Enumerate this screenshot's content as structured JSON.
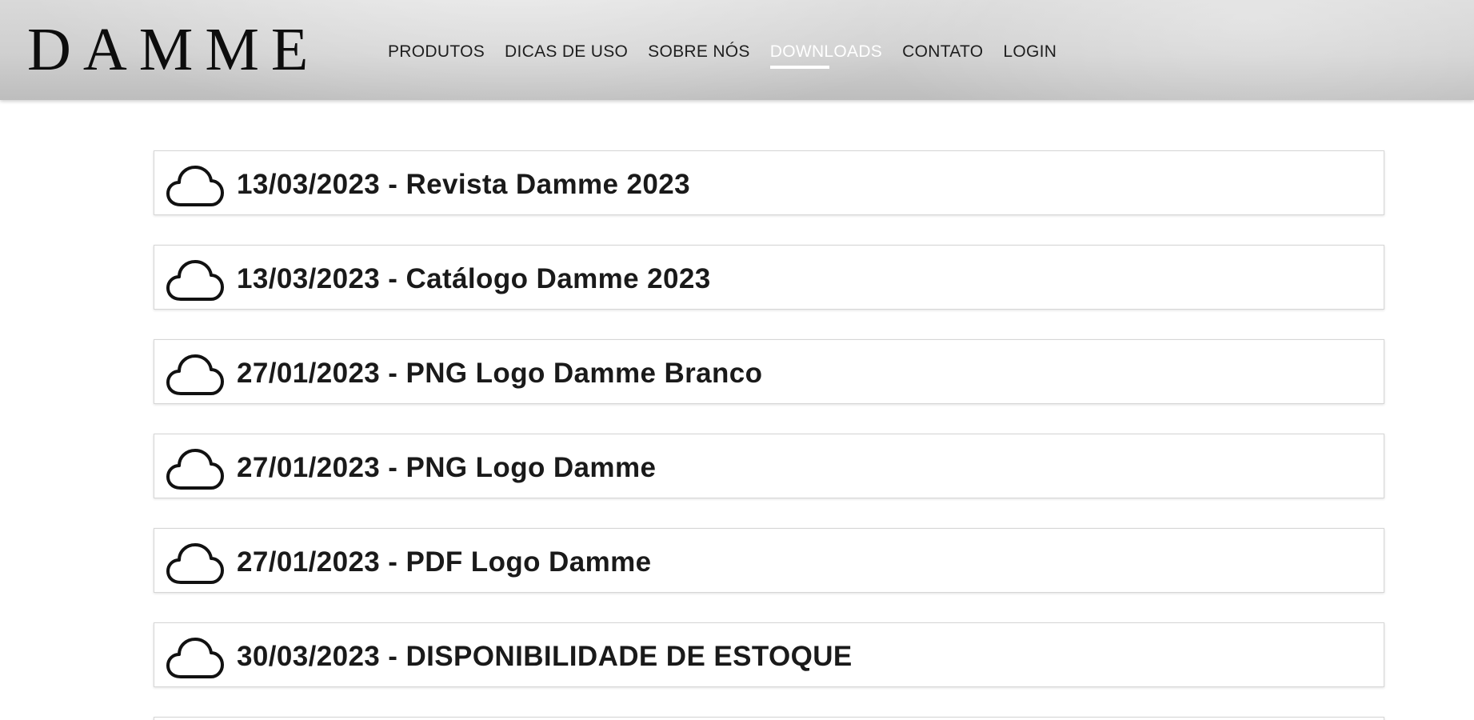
{
  "header": {
    "logo_text": "DAMME",
    "nav": [
      {
        "label": "PRODUTOS",
        "active": false
      },
      {
        "label": "DICAS DE USO",
        "active": false
      },
      {
        "label": "SOBRE NÓS",
        "active": false
      },
      {
        "label": "DOWNLOADS",
        "active": true
      },
      {
        "label": "CONTATO",
        "active": false
      },
      {
        "label": "LOGIN",
        "active": false
      }
    ]
  },
  "downloads": {
    "icon": "cloud-download-icon",
    "items": [
      {
        "label": "13/03/2023 - Revista Damme 2023"
      },
      {
        "label": "13/03/2023 - Catálogo Damme 2023"
      },
      {
        "label": "27/01/2023 - PNG Logo Damme Branco"
      },
      {
        "label": "27/01/2023 - PNG Logo Damme"
      },
      {
        "label": "27/01/2023 - PDF Logo Damme"
      },
      {
        "label": "30/03/2023 - DISPONIBILIDADE DE ESTOQUE"
      }
    ]
  },
  "colors": {
    "header_bg": "#cfcfcf",
    "active_nav": "#ffffff",
    "text": "#1a1a1a",
    "card_border": "#d6d6d6"
  }
}
